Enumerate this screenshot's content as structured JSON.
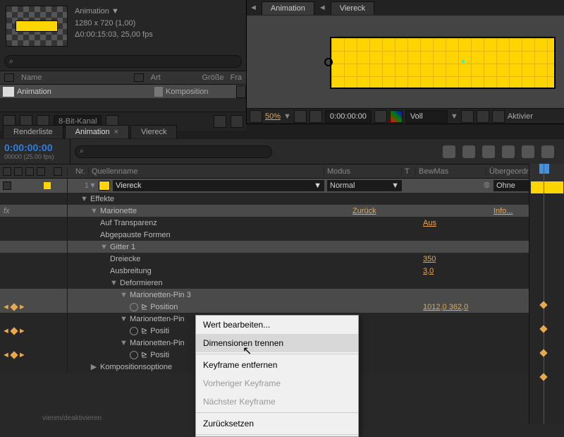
{
  "project": {
    "meta_line1": "Animation ▼",
    "meta_line2": "1280 x 720 (1,00)",
    "meta_line3": "Δ0:00:15:03, 25,00 fps",
    "search_icon": "⌕",
    "columns": {
      "name": "Name",
      "type": "Art",
      "size": "Größe",
      "fra": "Fra"
    },
    "item_name": "Animation",
    "item_type": "Komposition",
    "bit_label": "8-Bit-Kanal"
  },
  "composition": {
    "tab1": "Animation",
    "tab2": "Viereck",
    "zoom": "50%",
    "timecode": "0:00:00:00",
    "quality": "Voll",
    "activate": "Aktivier"
  },
  "timeline": {
    "tab_render": "Renderliste",
    "tab_anim": "Animation",
    "tab_rect": "Viereck",
    "close_x": "×",
    "timecode": "0:00:00:00",
    "tc_sub": "00000 (25.00 fps)",
    "col_nr": "Nr.",
    "col_source": "Quellenname",
    "col_mode": "Modus",
    "col_t": "T",
    "col_bew": "BewMas",
    "col_parent": "Übergeordnet",
    "layer_nr": "1",
    "layer_name": "Viereck",
    "mode_normal": "Normal",
    "parent_none": "Ohne",
    "dd_arrow": "▼"
  },
  "props": {
    "effects": "Effekte",
    "puppet": "Marionette",
    "reset": "Zurück",
    "info": "Info...",
    "transparency": "Auf Transparenz",
    "trans_val": "Aus",
    "paused": "Abgepauste Formen",
    "mesh": "Gitter 1",
    "triangles": "Dreiecke",
    "tri_val": "350",
    "expansion": "Ausbreitung",
    "exp_val": "3,0",
    "deform": "Deformieren",
    "pin3": "Marionetten-Pin 3",
    "pin2": "Marionetten-Pin",
    "pin1": "Marionetten-Pin",
    "position": "Positi",
    "position_full": "Position",
    "pos_val": "1012,0 362,0",
    "comp_opts": "Kompositionsoptione",
    "twist_down": "▼",
    "twist_right": "▶",
    "fx": "fx"
  },
  "context_menu": {
    "edit": "Wert bearbeiten...",
    "separate": "Dimensionen trennen",
    "remove_kf": "Keyframe entfernen",
    "prev_kf": "Vorheriger Keyframe",
    "next_kf": "Nächster Keyframe",
    "reset": "Zurücksetzen"
  },
  "status": "vieren/deaktivieren"
}
